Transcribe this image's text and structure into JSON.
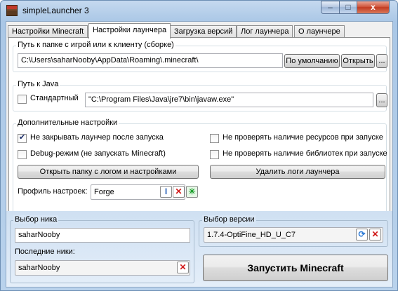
{
  "window": {
    "title": "simpleLauncher 3",
    "close_glyph": "x",
    "min_glyph": "–",
    "max_glyph": "□"
  },
  "tabs": [
    {
      "label": "Настройки Minecraft"
    },
    {
      "label": "Настройки лаунчера"
    },
    {
      "label": "Загрузка версий"
    },
    {
      "label": "Лог лаунчера"
    },
    {
      "label": "О лаунчере"
    }
  ],
  "game_path": {
    "label": "Путь к папке с игрой или к клиенту (сборке)",
    "value": "C:\\Users\\saharNooby\\AppData\\Roaming\\.minecraft\\",
    "default_button": "По умолчанию",
    "open_button": "Открыть",
    "browse_button": "..."
  },
  "java_path": {
    "label": "Путь к Java",
    "standard_label": "Стандартный",
    "standard_checked": false,
    "value": "\"C:\\Program Files\\Java\\jre7\\bin\\javaw.exe\"",
    "browse_button": "..."
  },
  "additional": {
    "label": "Дополнительные настройки",
    "keep_open": {
      "label": "Не закрывать лаунчер после запуска",
      "checked": true
    },
    "no_resource_check": {
      "label": "Не проверять наличие ресурсов при запуске",
      "checked": false
    },
    "debug_mode": {
      "label": "Debug-режим (не запускать Minecraft)",
      "checked": false
    },
    "no_library_check": {
      "label": "Не проверять наличие библиотек при запуске",
      "checked": false
    },
    "open_log_folder_button": "Открыть папку с логом и настройками",
    "delete_logs_button": "Удалить логи лаунчера",
    "profile_label": "Профиль настроек:",
    "profile_value": "Forge"
  },
  "nick": {
    "label": "Выбор ника",
    "value": "saharNooby",
    "recent_label": "Последние ники:",
    "recent_value": "saharNooby"
  },
  "version": {
    "label": "Выбор версии",
    "value": "1.7.4-OptiFine_HD_U_C7"
  },
  "launch_button": "Запустить Minecraft",
  "colors": {
    "accent": "#4f81bd",
    "delete": "#d11a1a",
    "add": "#1a9e2a"
  }
}
